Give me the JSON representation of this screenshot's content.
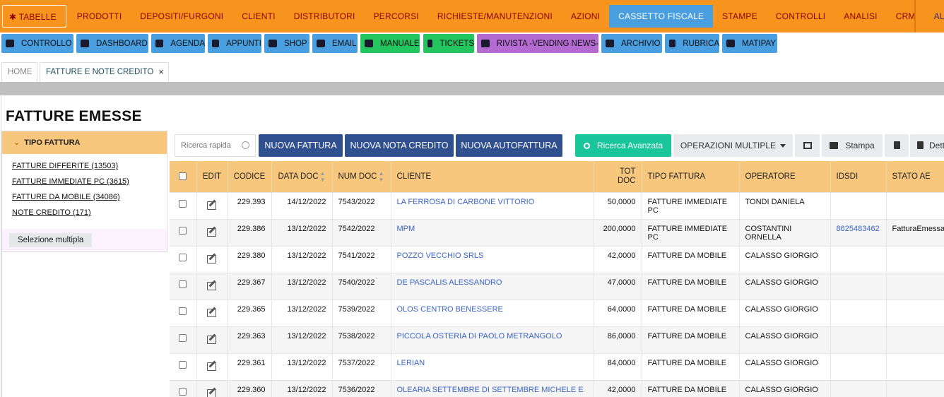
{
  "top_menu": {
    "items": [
      "TABELLE",
      "PRODOTTI",
      "DEPOSITI/FURGONI",
      "CLIENTI",
      "DISTRIBUTORI",
      "PERCORSI",
      "RICHIESTE/MANUTENZIONI",
      "AZIONI",
      "CASSETTO FISCALE",
      "STAMPE",
      "CONTROLLI",
      "ANALISI",
      "CRM",
      "ALTRO"
    ],
    "active": "CASSETTO FISCALE",
    "tabelle_icon": "gear-icon"
  },
  "quick_bar": {
    "items": [
      {
        "label": "CONTROLLO",
        "icon": "monitor-icon"
      },
      {
        "label": "DASHBOARD",
        "icon": "gauge-icon"
      },
      {
        "label": "AGENDA",
        "icon": "calendar-icon"
      },
      {
        "label": "APPUNTI",
        "icon": "clipboard-icon"
      },
      {
        "label": "SHOP",
        "icon": "cart-icon"
      },
      {
        "label": "EMAIL",
        "icon": "envelope-icon"
      },
      {
        "label": "MANUALE",
        "icon": "book-icon"
      },
      {
        "label": "TICKETS",
        "icon": "question-circle-icon"
      },
      {
        "label": "RIVISTA -VENDING NEWS-",
        "icon": "open-book-icon"
      },
      {
        "label": "ARCHIVIO",
        "icon": "folder-icon"
      },
      {
        "label": "RUBRICA",
        "icon": "address-book-icon"
      },
      {
        "label": "MATIPAY",
        "icon": "id-card-icon"
      }
    ],
    "colors": {
      "blue": "#4a9fe0",
      "green": "#22c55e",
      "purple": "#b36ad1"
    }
  },
  "tabs": {
    "home": "HOME",
    "active": "FATTURE E NOTE CREDITO",
    "close": "×"
  },
  "page": {
    "title": "FATTURE EMESSE"
  },
  "sidebar": {
    "header": "TIPO FATTURA",
    "items": [
      "FATTURE DIFFERITE  (13503)",
      "FATTURE IMMEDIATE PC  (3615)",
      "FATTURE DA MOBILE  (34086)",
      "NOTE CREDITO  (171)"
    ],
    "multi_select": "Selezione multipla"
  },
  "toolbar": {
    "search_placeholder": "Ricerca rapida",
    "new_invoice": "NUOVA FATTURA",
    "new_credit_note": "NUOVA NOTA CREDITO",
    "new_self_invoice": "NUOVA AUTOFATTURA",
    "advanced_search": "Ricerca Avanzata",
    "multiple_operations": "OPERAZIONI MULTIPLE",
    "print": "Stampa",
    "detail": "Dett"
  },
  "table": {
    "headers": {
      "edit": "EDIT",
      "codice": "CODICE",
      "data_doc": "DATA DOC",
      "num_doc": "NUM DOC",
      "cliente": "CLIENTE",
      "tot_doc_1": "TOT",
      "tot_doc_2": "DOC",
      "tipo_fattura": "TIPO FATTURA",
      "operatore": "OPERATORE",
      "idsdi": "IDSDI",
      "stato_ae": "STATO AE"
    },
    "rows": [
      {
        "codice": "229.393",
        "data": "14/12/2022",
        "num": "7543/2022",
        "cliente": "LA FERROSA DI CARBONE VITTORIO",
        "tot": "50,0000",
        "tipo": "FATTURE IMMEDIATE PC",
        "operatore": "TONDI DANIELA",
        "idsdi": "",
        "stato": ""
      },
      {
        "codice": "229.386",
        "data": "13/12/2022",
        "num": "7542/2022",
        "cliente": "MPM",
        "tot": "200,0000",
        "tipo": "FATTURE IMMEDIATE PC",
        "operatore": "COSTANTINI ORNELLA",
        "idsdi": "8625483462",
        "stato": "FatturaEmessa"
      },
      {
        "codice": "229.380",
        "data": "13/12/2022",
        "num": "7541/2022",
        "cliente": "POZZO VECCHIO SRLS",
        "tot": "42,0000",
        "tipo": "FATTURE DA MOBILE",
        "operatore": "CALASSO GIORGIO",
        "idsdi": "",
        "stato": ""
      },
      {
        "codice": "229.367",
        "data": "13/12/2022",
        "num": "7540/2022",
        "cliente": "DE PASCALIS ALESSANDRO",
        "tot": "47,0000",
        "tipo": "FATTURE DA MOBILE",
        "operatore": "CALASSO GIORGIO",
        "idsdi": "",
        "stato": ""
      },
      {
        "codice": "229.365",
        "data": "13/12/2022",
        "num": "7539/2022",
        "cliente": "OLOS CENTRO BENESSERE",
        "tot": "64,0000",
        "tipo": "FATTURE DA MOBILE",
        "operatore": "CALASSO GIORGIO",
        "idsdi": "",
        "stato": ""
      },
      {
        "codice": "229.363",
        "data": "13/12/2022",
        "num": "7538/2022",
        "cliente": "PICCOLA OSTERIA DI PAOLO METRANGOLO",
        "tot": "86,0000",
        "tipo": "FATTURE DA MOBILE",
        "operatore": "CALASSO GIORGIO",
        "idsdi": "",
        "stato": ""
      },
      {
        "codice": "229.361",
        "data": "13/12/2022",
        "num": "7537/2022",
        "cliente": "LERIAN",
        "tot": "84,0000",
        "tipo": "FATTURE DA MOBILE",
        "operatore": "CALASSO GIORGIO",
        "idsdi": "",
        "stato": ""
      },
      {
        "codice": "229.360",
        "data": "13/12/2022",
        "num": "7536/2022",
        "cliente": "OLEARIA SETTEMBRE DI SETTEMBRE MICHELE E",
        "tot": "42,0000",
        "tipo": "FATTURE DA MOBILE",
        "operatore": "CALASSO GIORGIO",
        "idsdi": "",
        "stato": ""
      }
    ]
  }
}
